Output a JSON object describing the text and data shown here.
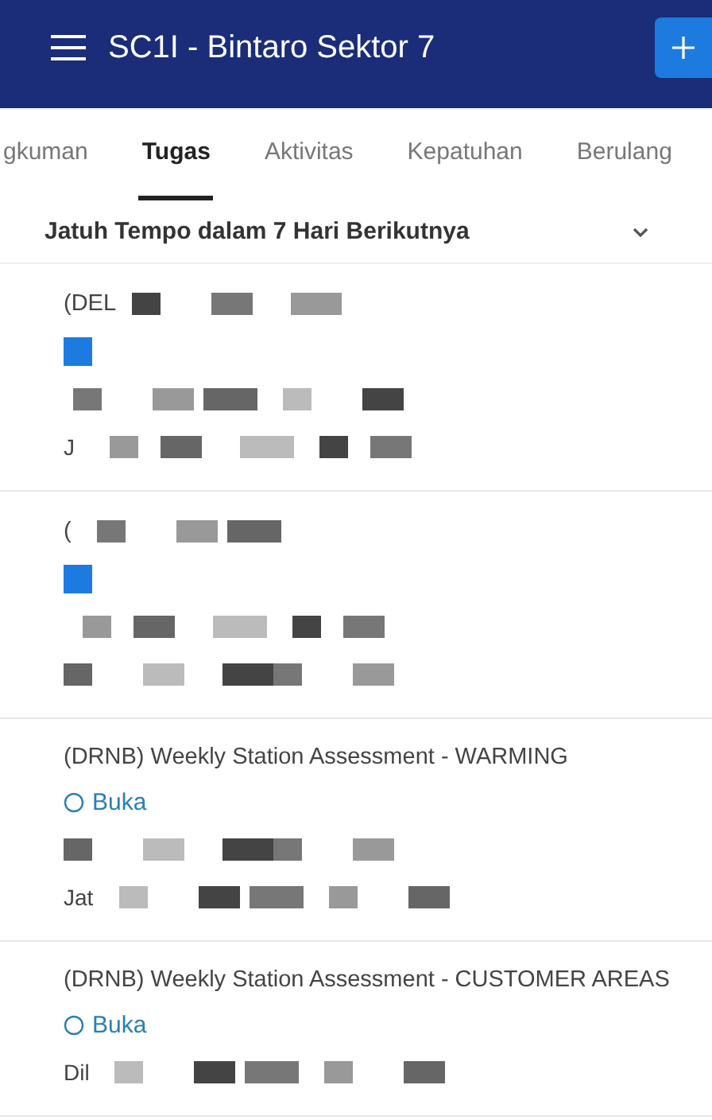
{
  "app_bar": {
    "title": "SC1I - Bintaro Sektor 7"
  },
  "tabs": [
    {
      "label": "gkuman",
      "selected": false
    },
    {
      "label": "Tugas",
      "selected": true
    },
    {
      "label": "Aktivitas",
      "selected": false
    },
    {
      "label": "Kepatuhan",
      "selected": false
    },
    {
      "label": "Berulang",
      "selected": false
    }
  ],
  "section": {
    "title": "Jatuh Tempo dalam 7 Hari Berikutnya",
    "expanded": true
  },
  "tasks": [
    {
      "title": "(DEL",
      "title_redacted": true,
      "status": {
        "redacted": true
      },
      "lines": [
        {
          "redacted": true
        },
        {
          "text": "J",
          "redacted": true
        }
      ]
    },
    {
      "title": "(",
      "title_redacted": true,
      "status": {
        "redacted": true
      },
      "lines": [
        {
          "redacted": true
        },
        {
          "redacted": true
        }
      ]
    },
    {
      "title": "(DRNB) Weekly Station Assessment - WARMING",
      "title_redacted": false,
      "status": {
        "text": "Buka",
        "redacted": false
      },
      "lines": [
        {
          "redacted": true
        },
        {
          "text": "Jat",
          "redacted": true
        }
      ]
    },
    {
      "title": "(DRNB) Weekly Station Assessment - CUSTOMER AREAS",
      "title_redacted": false,
      "status": {
        "text": "Buka",
        "redacted": false
      },
      "lines": [
        {
          "text": "Dil",
          "redacted": true
        }
      ]
    }
  ]
}
